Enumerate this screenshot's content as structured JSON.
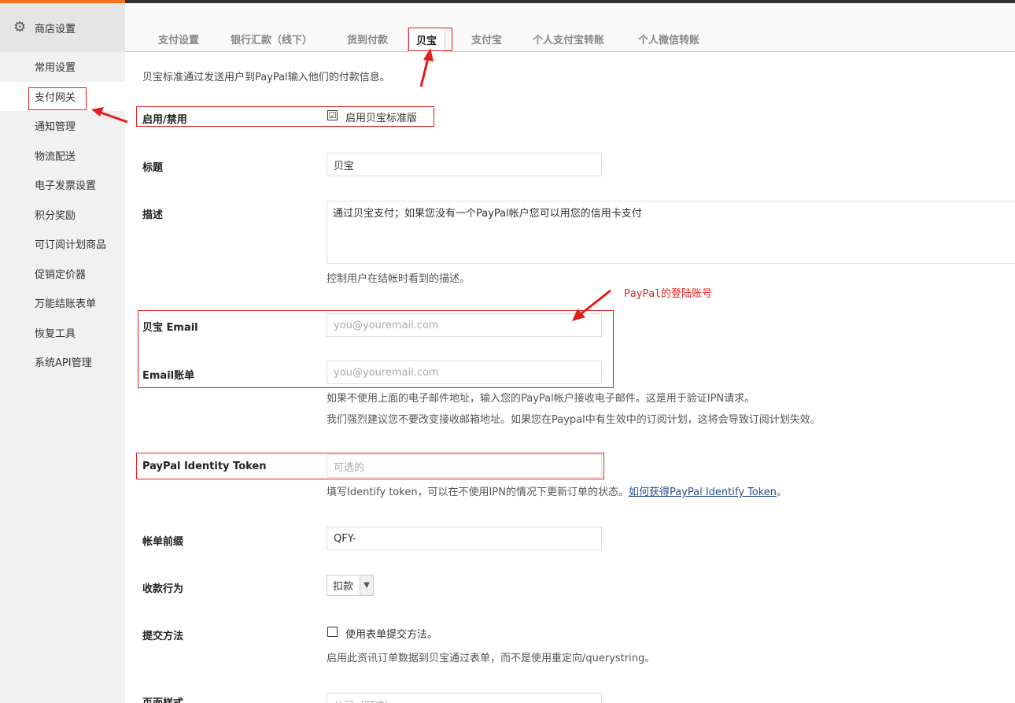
{
  "sidebar": {
    "header": "商店设置",
    "items": [
      {
        "label": "常用设置"
      },
      {
        "label": "支付网关"
      },
      {
        "label": "通知管理"
      },
      {
        "label": "物流配送"
      },
      {
        "label": "电子发票设置"
      },
      {
        "label": "积分奖励"
      },
      {
        "label": "可订阅计划商品"
      },
      {
        "label": "促销定价器"
      },
      {
        "label": "万能结账表单"
      },
      {
        "label": "恢复工具"
      },
      {
        "label": "系统API管理"
      }
    ]
  },
  "tabs": [
    {
      "label": "支付设置"
    },
    {
      "label": "银行汇款（线下）"
    },
    {
      "label": "货到付款"
    },
    {
      "label": "贝宝"
    },
    {
      "label": "支付宝"
    },
    {
      "label": "个人支付宝转账"
    },
    {
      "label": "个人微信转账"
    }
  ],
  "intro": "贝宝标准通过发送用户到PayPal输入他们的付款信息。",
  "form": {
    "enable_label": "启用/禁用",
    "enable_checkbox_label": "启用贝宝标准版",
    "enable_checked": "☑",
    "title_label": "标题",
    "title_value": "贝宝",
    "description_label": "描述",
    "description_value": "通过贝宝支付；如果您没有一个PayPal帐户您可以用您的信用卡支付",
    "description_help": "控制用户在结帐时看到的描述。",
    "email_label": "贝宝 Email",
    "email_placeholder": "you@youremail.com",
    "receiver_label": "Email账单",
    "receiver_placeholder": "you@youremail.com",
    "receiver_help_1": "如果不使用上面的电子邮件地址，输入您的PayPal帐户接收电子邮件。这是用于验证IPN请求。",
    "receiver_help_2": "我们强烈建议您不要改变接收邮箱地址。如果您在Paypal中有生效中的订阅计划，这将会导致订阅计划失效。",
    "token_label": "PayPal Identity Token",
    "token_placeholder": "可选的",
    "token_help": "填写Identify token，可以在不使用IPN的情况下更新订单的状态。",
    "token_help_link": "如何获得PayPal Identify Token",
    "token_help_end": "。",
    "prefix_label": "帐单前缀",
    "prefix_value": "QFY-",
    "action_label": "收款行为",
    "action_value": "扣款",
    "submit_label": "提交方法",
    "submit_checkbox_label": "使用表单提交方法。",
    "submit_help": "启用此资讯订单数据到贝宝通过表单，而不是使用重定向/querystring。",
    "page_style_label": "页面样式",
    "page_style_placeholder": "公司（可选）"
  },
  "annotation": {
    "paypal_login": "PayPal的登陆账号"
  },
  "colors": {
    "accent": "#f5731e",
    "annotation": "#e02020"
  }
}
